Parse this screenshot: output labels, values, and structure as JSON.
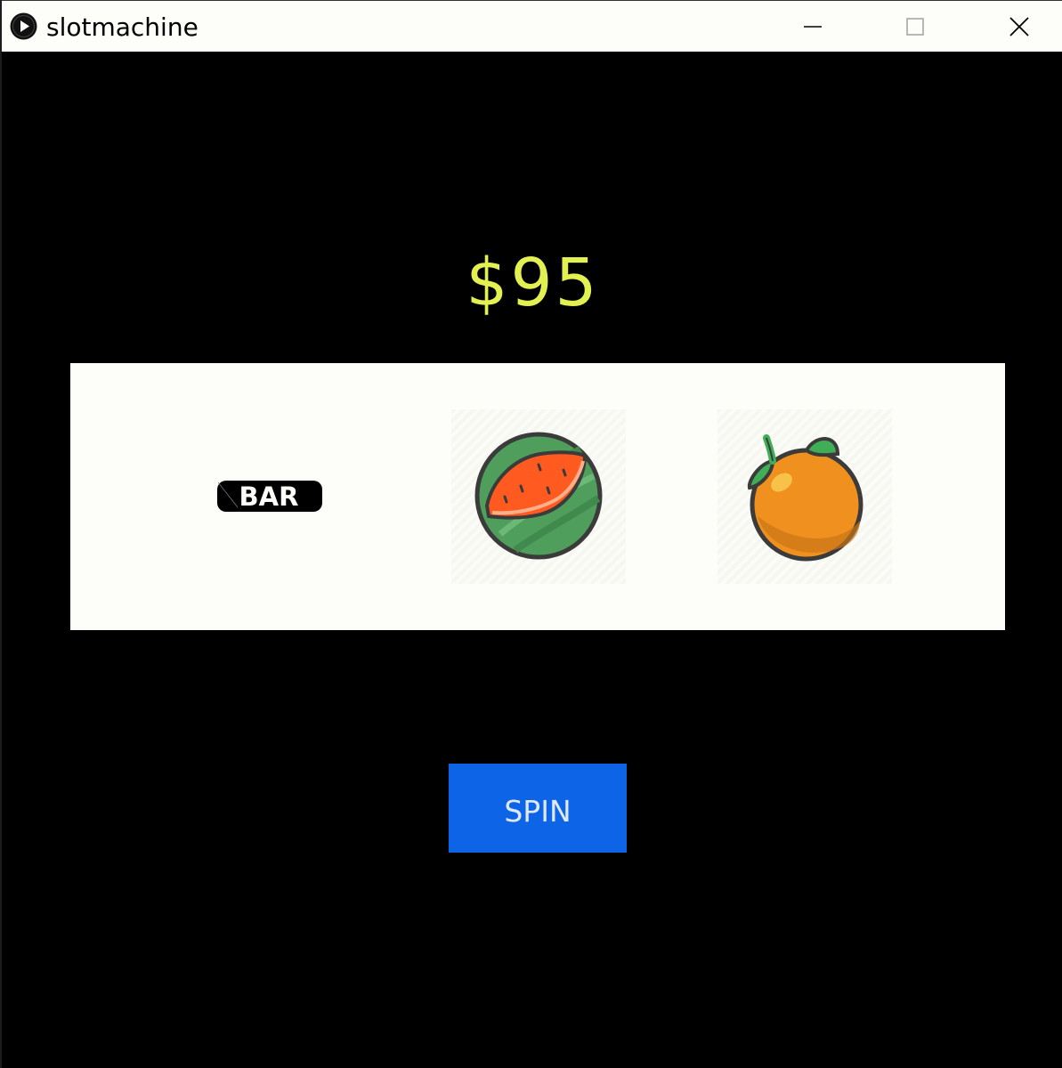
{
  "window": {
    "title": "slotmachine",
    "app_icon": "play-icon",
    "controls": [
      "minimize-icon",
      "maximize-icon",
      "close-icon"
    ]
  },
  "balance": {
    "text": "$95"
  },
  "reels": [
    {
      "symbol": "bar",
      "label": "BAR",
      "icon": "bar-icon"
    },
    {
      "symbol": "watermelon",
      "icon": "watermelon-icon"
    },
    {
      "symbol": "orange",
      "icon": "orange-icon"
    }
  ],
  "spin_button": {
    "label": "SPIN"
  },
  "colors": {
    "balance_text": "#e2f051",
    "spin_button_bg": "#0d64e6",
    "reels_panel_bg": "#fdfdfa",
    "background": "#000000"
  }
}
